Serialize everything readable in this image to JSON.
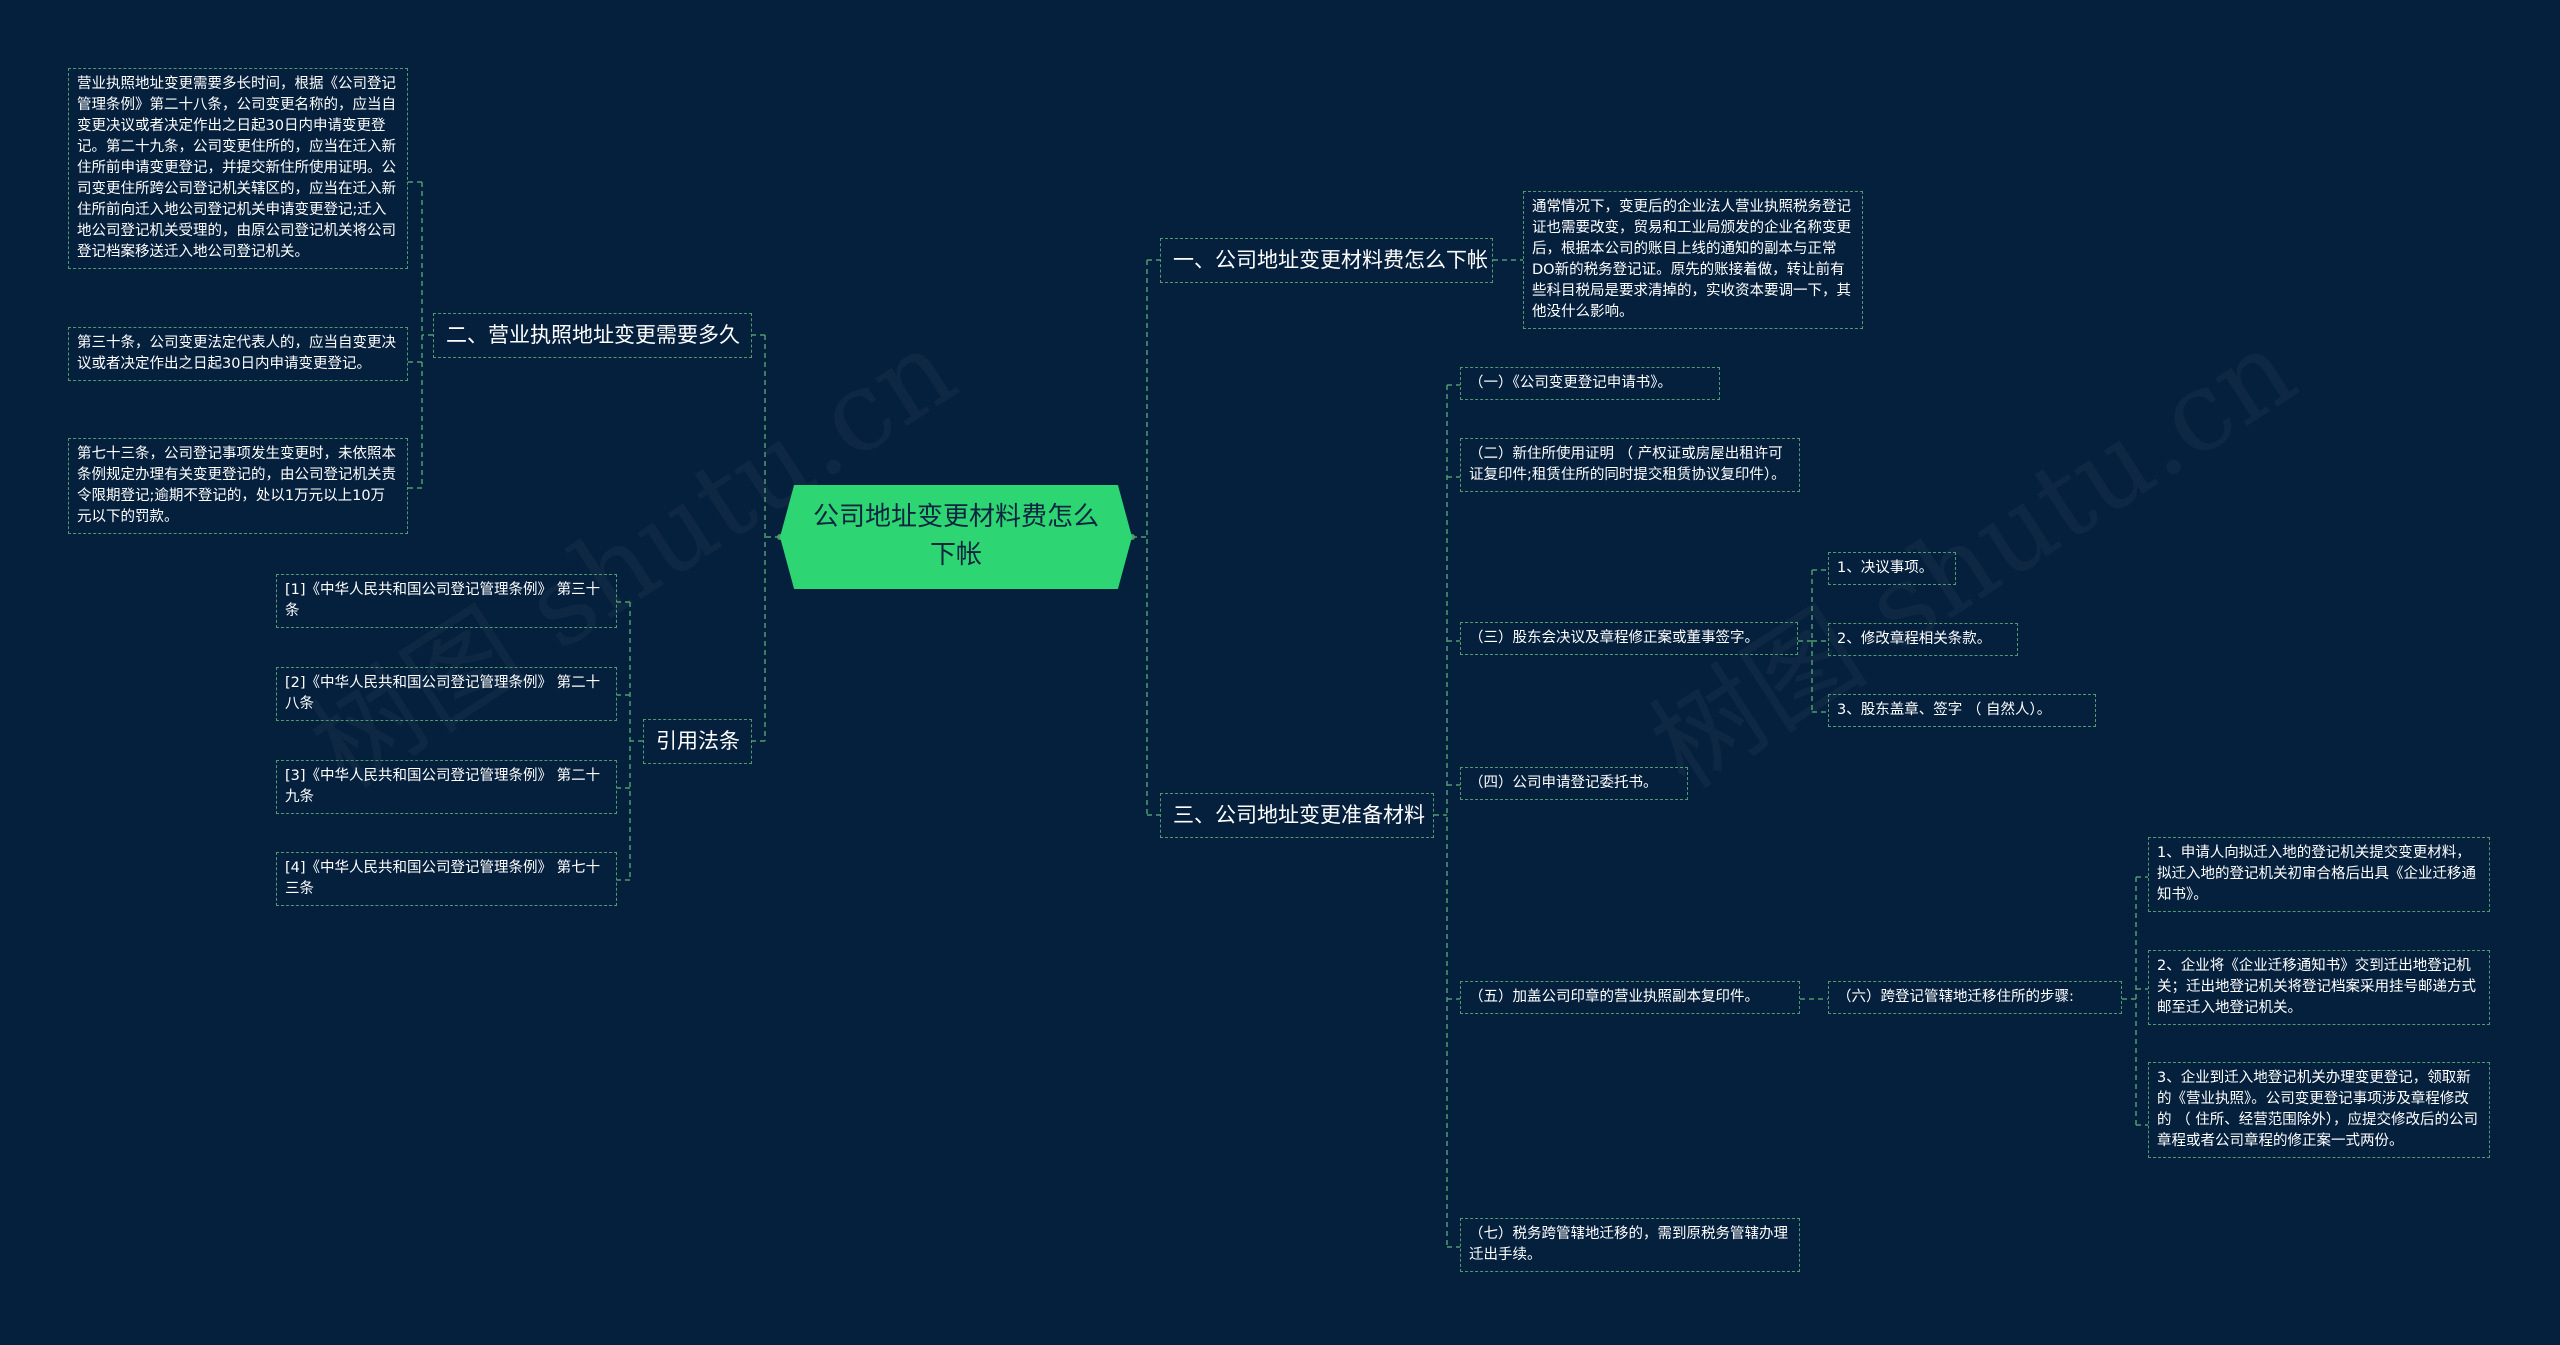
{
  "root": {
    "label": "公司地址变更材料费怎么下帐"
  },
  "branches": {
    "b1": "一、公司地址变更材料费怎么下帐",
    "b2": "二、营业执照地址变更需要多久",
    "b3": "三、公司地址变更准备材料",
    "b4": "引用法条"
  },
  "b1_children": {
    "c1": "通常情况下，变更后的企业法人营业执照税务登记证也需要改变，贸易和工业局颁发的企业名称变更后，根据本公司的账目上线的通知的副本与正常DO新的税务登记证。原先的账接着做，转让前有些科目税局是要求清掉的，实收资本要调一下，其他没什么影响。"
  },
  "b2_children": {
    "c1": "营业执照地址变更需要多长时间，根据《公司登记管理条例》第二十八条，公司变更名称的，应当自变更决议或者决定作出之日起30日内申请变更登记。第二十九条，公司变更住所的，应当在迁入新住所前申请变更登记，并提交新住所使用证明。公司变更住所跨公司登记机关辖区的，应当在迁入新住所前向迁入地公司登记机关申请变更登记;迁入地公司登记机关受理的，由原公司登记机关将公司登记档案移送迁入地公司登记机关。",
    "c2": "第三十条，公司变更法定代表人的，应当自变更决议或者决定作出之日起30日内申请变更登记。",
    "c3": "第七十三条，公司登记事项发生变更时，未依照本条例规定办理有关变更登记的，由公司登记机关责令限期登记;逾期不登记的，处以1万元以上10万元以下的罚款。"
  },
  "b3_children": {
    "c1": "（一）《公司变更登记申请书》。",
    "c2": "（二）新住所使用证明 （ 产权证或房屋出租许可证复印件;租赁住所的同时提交租赁协议复印件）。",
    "c3": "（三）股东会决议及章程修正案或董事签字。",
    "c3_items": [
      "1、决议事项。",
      "2、修改章程相关条款。",
      "3、股东盖章、签字 （ 自然人）。"
    ],
    "c4": "（四）公司申请登记委托书。",
    "c5": "（五）加盖公司印章的营业执照副本复印件。",
    "c6": "（六）跨登记管辖地迁移住所的步骤:",
    "c6_items": [
      "1、申请人向拟迁入地的登记机关提交变更材料，拟迁入地的登记机关初审合格后出具《企业迁移通知书》。",
      "2、企业将《企业迁移通知书》交到迁出地登记机关；迁出地登记机关将登记档案采用挂号邮递方式邮至迁入地登记机关。",
      "3、企业到迁入地登记机关办理变更登记，领取新的《营业执照》。公司变更登记事项涉及章程修改的 （ 住所、经营范围除外），应提交修改后的公司章程或者公司章程的修正案一式两份。"
    ],
    "c7": "（七）税务跨管辖地迁移的，需到原税务管辖办理迁出手续。"
  },
  "b4_children": [
    "[1]《中华人民共和国公司登记管理条例》 第三十条",
    "[2]《中华人民共和国公司登记管理条例》 第二十八条",
    "[3]《中华人民共和国公司登记管理条例》 第二十九条",
    "[4]《中华人民共和国公司登记管理条例》 第七十三条"
  ],
  "watermark": "树图 shutu.cn",
  "colors": {
    "background": "#05203d",
    "root": "#2ed573",
    "line": "#4f9a6e",
    "text": "#ffffff"
  }
}
